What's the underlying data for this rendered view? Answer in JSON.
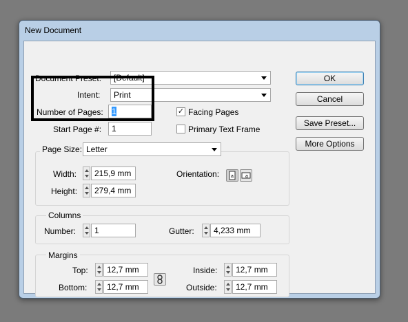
{
  "window": {
    "title": "New Document"
  },
  "preset": {
    "label": "Document Preset:",
    "value": "[Default]"
  },
  "intent": {
    "label": "Intent:",
    "value": "Print"
  },
  "pages": {
    "number_label": "Number of Pages:",
    "number_value": "1",
    "start_label": "Start Page #:",
    "start_value": "1"
  },
  "options": {
    "facing_pages": "Facing Pages",
    "facing_checked": true,
    "primary_frame": "Primary Text Frame",
    "primary_checked": false
  },
  "buttons": {
    "ok": "OK",
    "cancel": "Cancel",
    "save_preset": "Save Preset...",
    "more_options": "More Options"
  },
  "page_size": {
    "label": "Page Size:",
    "value": "Letter",
    "width_label": "Width:",
    "width_value": "215,9 mm",
    "height_label": "Height:",
    "height_value": "279,4 mm",
    "orientation_label": "Orientation:"
  },
  "columns": {
    "title": "Columns",
    "number_label": "Number:",
    "number_value": "1",
    "gutter_label": "Gutter:",
    "gutter_value": "4,233 mm"
  },
  "margins": {
    "title": "Margins",
    "top_label": "Top:",
    "top_value": "12,7 mm",
    "bottom_label": "Bottom:",
    "bottom_value": "12,7 mm",
    "inside_label": "Inside:",
    "inside_value": "12,7 mm",
    "outside_label": "Outside:",
    "outside_value": "12,7 mm"
  },
  "colors": {
    "desktop": "#7b7b7b",
    "frame": "#b9cfe6",
    "client": "#f0f0f0",
    "annotation_box": "#000000"
  }
}
